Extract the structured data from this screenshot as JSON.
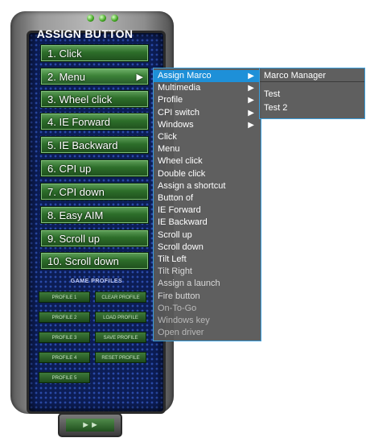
{
  "panel": {
    "title": "ASSIGN BUTTON",
    "buttons": [
      {
        "label": "1. Click"
      },
      {
        "label": "2. Menu"
      },
      {
        "label": "3. Wheel click"
      },
      {
        "label": "4. IE Forward"
      },
      {
        "label": "5. IE Backward"
      },
      {
        "label": "6. CPI up"
      },
      {
        "label": "7. CPI down"
      },
      {
        "label": "8. Easy AIM"
      },
      {
        "label": "9. Scroll up"
      },
      {
        "label": "10. Scroll down"
      }
    ],
    "game_profiles_title": "GAME PROFILES",
    "profiles": [
      "PROFILE 1",
      "CLEAR PROFILE",
      "PROFILE 2",
      "LOAD PROFILE",
      "PROFILE 3",
      "SAVE PROFILE",
      "PROFILE 4",
      "RESET PROFILE",
      "PROFILE 5"
    ],
    "bottom_button": "►►"
  },
  "menu": {
    "items": [
      {
        "label": "Assign Marco",
        "submenu": true
      },
      {
        "label": "Multimedia",
        "submenu": true
      },
      {
        "label": "Profile",
        "submenu": true
      },
      {
        "label": "CPI switch",
        "submenu": true
      },
      {
        "label": "Windows",
        "submenu": true
      },
      {
        "label": "Click"
      },
      {
        "label": "Menu"
      },
      {
        "label": "Wheel click"
      },
      {
        "label": "Double click"
      },
      {
        "label": "Assign a shortcut"
      },
      {
        "label": "Button of"
      },
      {
        "label": "IE Forward"
      },
      {
        "label": "IE Backward"
      },
      {
        "label": "Scroll up"
      },
      {
        "label": "Scroll down"
      },
      {
        "label": "Tilt Left"
      },
      {
        "label": "Tilt Right"
      },
      {
        "label": "Assign a launch"
      },
      {
        "label": "Fire button"
      },
      {
        "label": "On-To-Go"
      },
      {
        "label": "Windows key"
      },
      {
        "label": "Open driver"
      }
    ],
    "arrow_glyph": "▶"
  },
  "submenu": {
    "items": [
      {
        "label": "Marco Manager"
      },
      {
        "label": "Test"
      },
      {
        "label": "Test 2"
      }
    ]
  },
  "colors": {
    "highlight": "#1e90d8",
    "menu_bg": "#585858",
    "menu_border": "#3b9fdd",
    "button_green": "#2d6e2a",
    "panel_blue": "#0c1d55"
  }
}
